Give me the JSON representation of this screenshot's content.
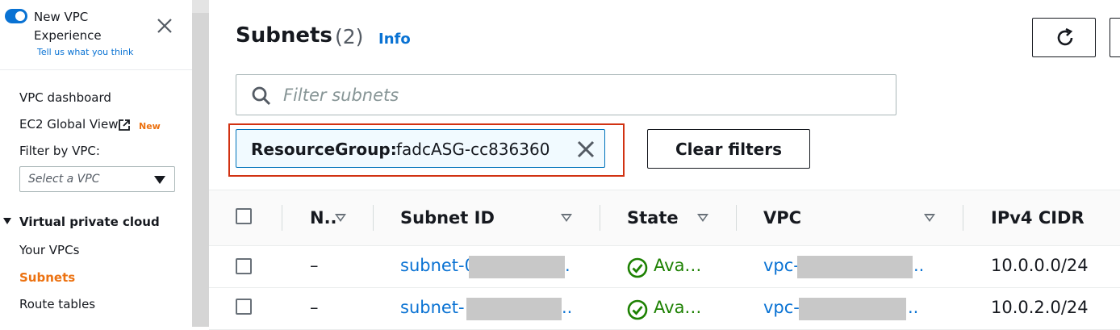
{
  "sidebar": {
    "title": "New VPC Experience",
    "feedback": "Tell us what you think",
    "nav": {
      "dashboard": "VPC dashboard",
      "ec2_global": "EC2 Global View",
      "new_badge": "New",
      "filter_label": "Filter by VPC:",
      "vpc_select_placeholder": "Select a VPC"
    },
    "section": "Virtual private cloud",
    "section_items": [
      "Your VPCs",
      "Subnets",
      "Route tables"
    ]
  },
  "header": {
    "title": "Subnets",
    "count": "(2)",
    "info": "Info"
  },
  "search": {
    "placeholder": "Filter subnets",
    "value": ""
  },
  "filter_token": {
    "key": "ResourceGroup:",
    "value": "fadcASG-cc836360"
  },
  "clear_filters": "Clear filters",
  "table": {
    "columns": [
      "N..",
      "Subnet ID",
      "State",
      "VPC",
      "IPv4 CIDR"
    ],
    "rows": [
      {
        "name": "–",
        "subnet_id": "subnet-0",
        "subnet_suffix": ".",
        "state": "Ava…",
        "vpc": "vpc-",
        "vpc_suffix": "..",
        "cidr": "10.0.0.0/24"
      },
      {
        "name": "–",
        "subnet_id": "subnet-",
        "subnet_suffix": "..",
        "state": "Ava…",
        "vpc": "vpc-",
        "vpc_suffix": "..",
        "cidr": "10.0.2.0/24"
      }
    ]
  },
  "colors": {
    "accent": "#0972d3",
    "active_nav": "#ec7211",
    "success": "#1d8102",
    "highlight": "#d13212"
  }
}
